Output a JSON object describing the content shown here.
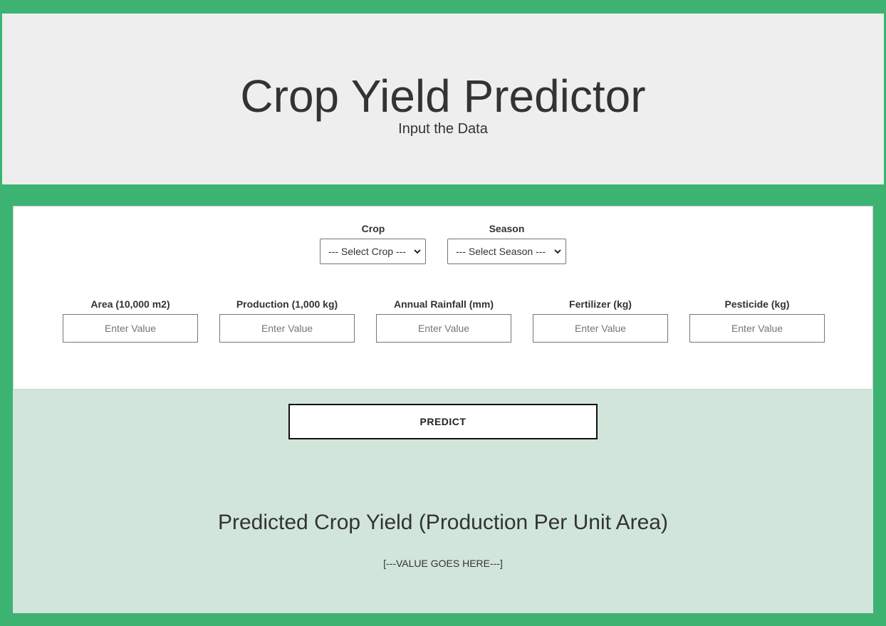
{
  "header": {
    "title": "Crop Yield Predictor",
    "subtitle": "Input the Data"
  },
  "form": {
    "crop": {
      "label": "Crop",
      "selected": "--- Select Crop ---"
    },
    "season": {
      "label": "Season",
      "selected": "--- Select Season ---"
    },
    "fields": [
      {
        "label": "Area (10,000 m2)",
        "placeholder": "Enter Value",
        "value": ""
      },
      {
        "label": "Production (1,000 kg)",
        "placeholder": "Enter Value",
        "value": ""
      },
      {
        "label": "Annual Rainfall (mm)",
        "placeholder": "Enter Value",
        "value": ""
      },
      {
        "label": "Fertilizer (kg)",
        "placeholder": "Enter Value",
        "value": ""
      },
      {
        "label": "Pesticide (kg)",
        "placeholder": "Enter Value",
        "value": ""
      }
    ]
  },
  "predict_button": {
    "label": "PREDICT"
  },
  "result": {
    "title": "Predicted Crop Yield (Production Per Unit Area)",
    "value": "[---VALUE GOES HERE---]"
  },
  "colors": {
    "page_background": "#3cb371",
    "header_background": "#eeeeee",
    "form_background": "#ffffff",
    "result_background": "#d1e5db"
  },
  "icons": {
    "select_caret": "chevron-down-icon"
  }
}
